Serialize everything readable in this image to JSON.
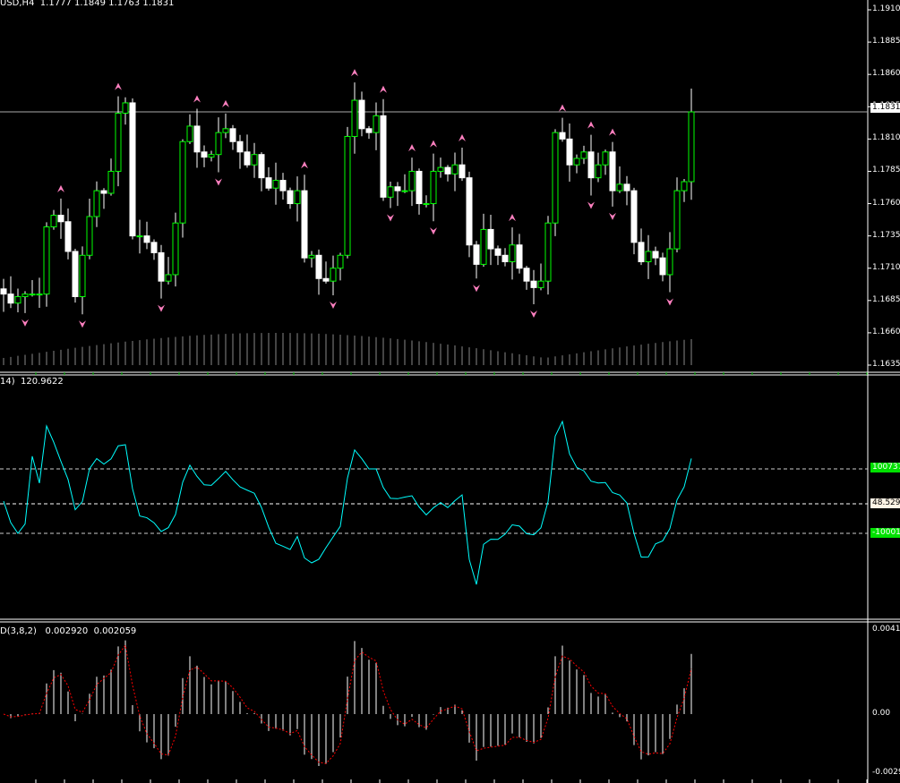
{
  "header": {
    "symbol": "USD,H4",
    "open": "1.1777",
    "high": "1.1849",
    "low": "1.1763",
    "close": "1.1831"
  },
  "cci_panel": {
    "label": "14)",
    "value": "120.9622",
    "level_high": "100",
    "level_low": "-100",
    "level_mid": "48.529",
    "tag_high": "737",
    "tag_low": "01"
  },
  "osma_panel": {
    "label": "D(3,8,2)",
    "value1": "0.002920",
    "value2": "0.002059",
    "axis": [
      "0.00415",
      "0.00",
      "-0.0029"
    ]
  },
  "current_price": "1.1831",
  "colors": {
    "bull": "#ffffff",
    "bear": "#000000",
    "wick": "#00ff00",
    "arrow": "#ff80c0",
    "cci": "#00ffff",
    "signal": "#ff0000"
  },
  "chart_data": {
    "type": "candlestick",
    "title": "USD,H4",
    "price_axis": [
      "1.1910",
      "1.1885",
      "1.1860",
      "1.1835",
      "1.1810",
      "1.1785",
      "1.1760",
      "1.1735",
      "1.1710",
      "1.1685",
      "1.1660",
      "1.1635"
    ],
    "ylim": [
      1.1635,
      1.191
    ],
    "closes": [
      1.169,
      1.1683,
      1.1688,
      1.169,
      1.169,
      1.169,
      1.1742,
      1.1751,
      1.1746,
      1.1723,
      1.1688,
      1.172,
      1.175,
      1.177,
      1.1768,
      1.1785,
      1.183,
      1.1838,
      1.1735,
      1.1735,
      1.173,
      1.1722,
      1.17,
      1.1705,
      1.1745,
      1.1808,
      1.182,
      1.18,
      1.1796,
      1.1798,
      1.1815,
      1.1818,
      1.1808,
      1.18,
      1.179,
      1.1798,
      1.178,
      1.1772,
      1.1778,
      1.177,
      1.176,
      1.177,
      1.1718,
      1.172,
      1.1702,
      1.17,
      1.171,
      1.172,
      1.1812,
      1.184,
      1.1818,
      1.1815,
      1.1828,
      1.1765,
      1.1773,
      1.177,
      1.177,
      1.1785,
      1.176,
      1.176,
      1.1785,
      1.1788,
      1.1783,
      1.179,
      1.178,
      1.1728,
      1.1713,
      1.174,
      1.1725,
      1.172,
      1.1715,
      1.1728,
      1.171,
      1.17,
      1.1695,
      1.17,
      1.1745,
      1.1815,
      1.181,
      1.179,
      1.1795,
      1.18,
      1.178,
      1.179,
      1.18,
      1.177,
      1.1775,
      1.177,
      1.173,
      1.1715,
      1.1723,
      1.1718,
      1.1705,
      1.1725,
      1.177,
      1.1777,
      1.1831
    ],
    "last_candle": {
      "open": 1.1777,
      "high": 1.1849,
      "low": 1.1763,
      "close": 1.1831
    }
  }
}
